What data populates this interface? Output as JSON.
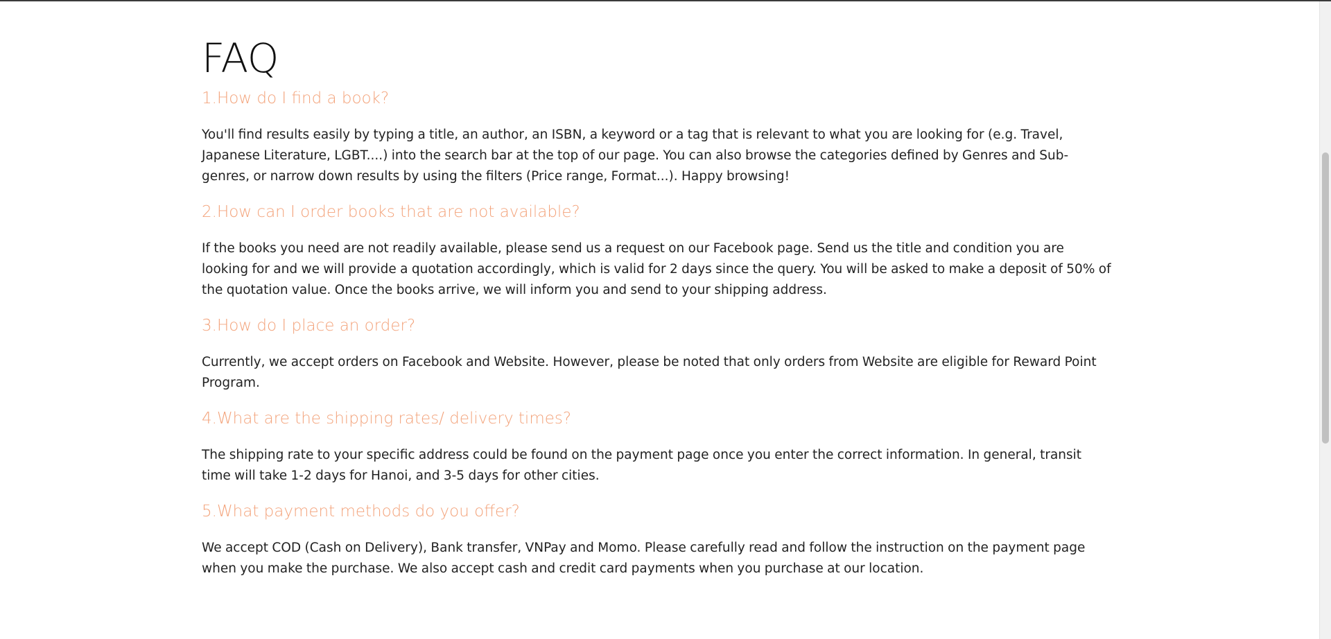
{
  "page": {
    "title": "FAQ"
  },
  "faq": [
    {
      "question": "1.How do I find a book?",
      "answer": "You'll find results easily by typing a title, an author, an ISBN, a keyword or a tag that is relevant to what you are looking for (e.g. Travel, Japanese Literature, LGBT....) into the search bar at the top of our page. You can also browse the categories defined by Genres and Sub-genres, or narrow down results by using the filters (Price range, Format...). Happy browsing!"
    },
    {
      "question": "2.How can I order books that are not available?",
      "answer": "If the books you need are not readily available, please send us a request on our Facebook page. Send us the title and condition you are looking for and we will provide a quotation accordingly, which is valid for 2 days since the query. You will be asked to make a deposit of 50% of the quotation value. Once the books arrive, we will inform you and send to your shipping address."
    },
    {
      "question": "3.How do I place an order?",
      "answer": "Currently, we accept orders on Facebook and Website. However, please be noted that only orders from Website are eligible for Reward Point Program."
    },
    {
      "question": "4.What are the shipping rates/ delivery times?",
      "answer": "The shipping rate to your specific address could be found on the payment page once you enter the correct information. In general, transit time will take 1-2 days for Hanoi, and 3-5 days for other cities."
    },
    {
      "question": "5.What payment methods do you offer?",
      "answer": "We accept COD (Cash on Delivery), Bank transfer, VNPay and Momo. Please carefully read and follow the instruction on the payment page when you make the purchase. We also accept cash and credit card payments when you purchase at our location."
    }
  ],
  "colors": {
    "question": "#f3a37b",
    "answer": "#222222",
    "title": "#111111"
  }
}
